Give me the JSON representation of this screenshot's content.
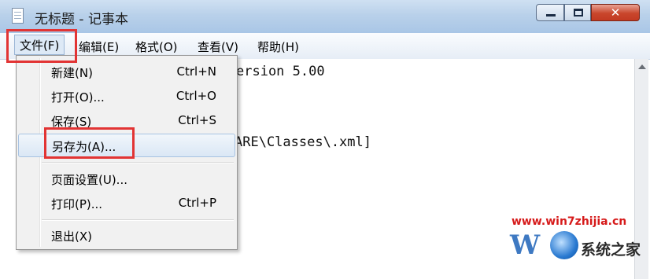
{
  "window": {
    "title": "无标题 - 记事本"
  },
  "menubar": {
    "items": [
      "文件(F)",
      "编辑(E)",
      "格式(O)",
      "查看(V)",
      "帮助(H)"
    ]
  },
  "file_menu": {
    "items": [
      {
        "label": "新建(N)",
        "shortcut": "Ctrl+N"
      },
      {
        "label": "打开(O)...",
        "shortcut": "Ctrl+O"
      },
      {
        "label": "保存(S)",
        "shortcut": "Ctrl+S"
      },
      {
        "label": "另存为(A)...",
        "shortcut": ""
      },
      {
        "label": "页面设置(U)...",
        "shortcut": ""
      },
      {
        "label": "打印(P)...",
        "shortcut": "Ctrl+P"
      },
      {
        "label": "退出(X)",
        "shortcut": ""
      }
    ],
    "hovered_item": "另存为(A)..."
  },
  "editor": {
    "visible_text": [
      "ersion 5.00",
      "ARE\\Classes\\.xml]"
    ]
  },
  "highlight_color": "#e23434",
  "watermark": {
    "url": "www.win7zhijia.cn",
    "brand": "系统之家"
  }
}
